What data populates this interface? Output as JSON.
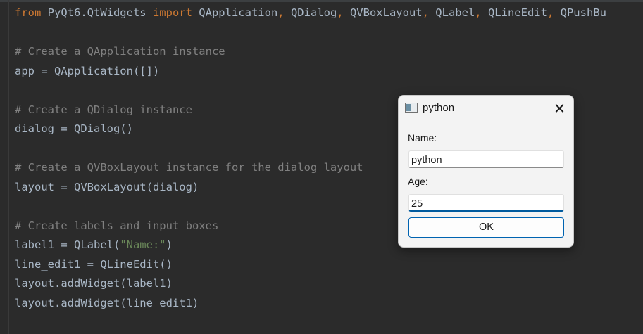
{
  "editor": {
    "lines": [
      {
        "segments": [
          {
            "text": "from",
            "kind": "kw"
          },
          {
            "text": " PyQt6.QtWidgets ",
            "kind": "plain"
          },
          {
            "text": "import",
            "kind": "kw"
          },
          {
            "text": " QApplication",
            "kind": "plain"
          },
          {
            "text": ",",
            "kind": "kw"
          },
          {
            "text": " QDialog",
            "kind": "plain"
          },
          {
            "text": ",",
            "kind": "kw"
          },
          {
            "text": " QVBoxLayout",
            "kind": "plain"
          },
          {
            "text": ",",
            "kind": "kw"
          },
          {
            "text": " QLabel",
            "kind": "plain"
          },
          {
            "text": ",",
            "kind": "kw"
          },
          {
            "text": " QLineEdit",
            "kind": "plain"
          },
          {
            "text": ",",
            "kind": "kw"
          },
          {
            "text": " QPushBu",
            "kind": "plain"
          }
        ]
      },
      {
        "segments": []
      },
      {
        "segments": [
          {
            "text": "# Create a QApplication instance",
            "kind": "cm"
          }
        ]
      },
      {
        "segments": [
          {
            "text": "app = QApplication([])",
            "kind": "plain"
          }
        ]
      },
      {
        "segments": []
      },
      {
        "segments": [
          {
            "text": "# Create a QDialog instance",
            "kind": "cm"
          }
        ]
      },
      {
        "segments": [
          {
            "text": "dialog = QDialog()",
            "kind": "plain"
          }
        ]
      },
      {
        "segments": []
      },
      {
        "segments": [
          {
            "text": "# Create a QVBoxLayout instance for the dialog layout",
            "kind": "cm"
          }
        ]
      },
      {
        "segments": [
          {
            "text": "layout = QVBoxLayout(dialog)",
            "kind": "plain"
          }
        ]
      },
      {
        "segments": []
      },
      {
        "segments": [
          {
            "text": "# Create labels and input boxes",
            "kind": "cm"
          }
        ]
      },
      {
        "segments": [
          {
            "text": "label1 = QLabel(",
            "kind": "plain"
          },
          {
            "text": "\"Name:\"",
            "kind": "str"
          },
          {
            "text": ")",
            "kind": "plain"
          }
        ]
      },
      {
        "segments": [
          {
            "text": "line_edit1 = QLineEdit()",
            "kind": "plain"
          }
        ]
      },
      {
        "segments": [
          {
            "text": "layout.addWidget(label1)",
            "kind": "plain"
          }
        ]
      },
      {
        "segments": [
          {
            "text": "layout.addWidget(line_edit1)",
            "kind": "plain"
          }
        ]
      }
    ]
  },
  "dialog": {
    "title": "python",
    "name_label": "Name:",
    "name_value": "python",
    "age_label": "Age:",
    "age_value": "25",
    "ok_label": "OK",
    "focused_field": "age"
  },
  "colors": {
    "editor_bg": "#2b2b2b",
    "keyword": "#cc7832",
    "comment": "#808080",
    "string": "#6a8759",
    "text": "#a9b7c6",
    "dialog_bg": "#f3f3f3",
    "focus_accent": "#005a9e"
  },
  "icons": {
    "app": "window-icon",
    "close": "close-icon"
  }
}
